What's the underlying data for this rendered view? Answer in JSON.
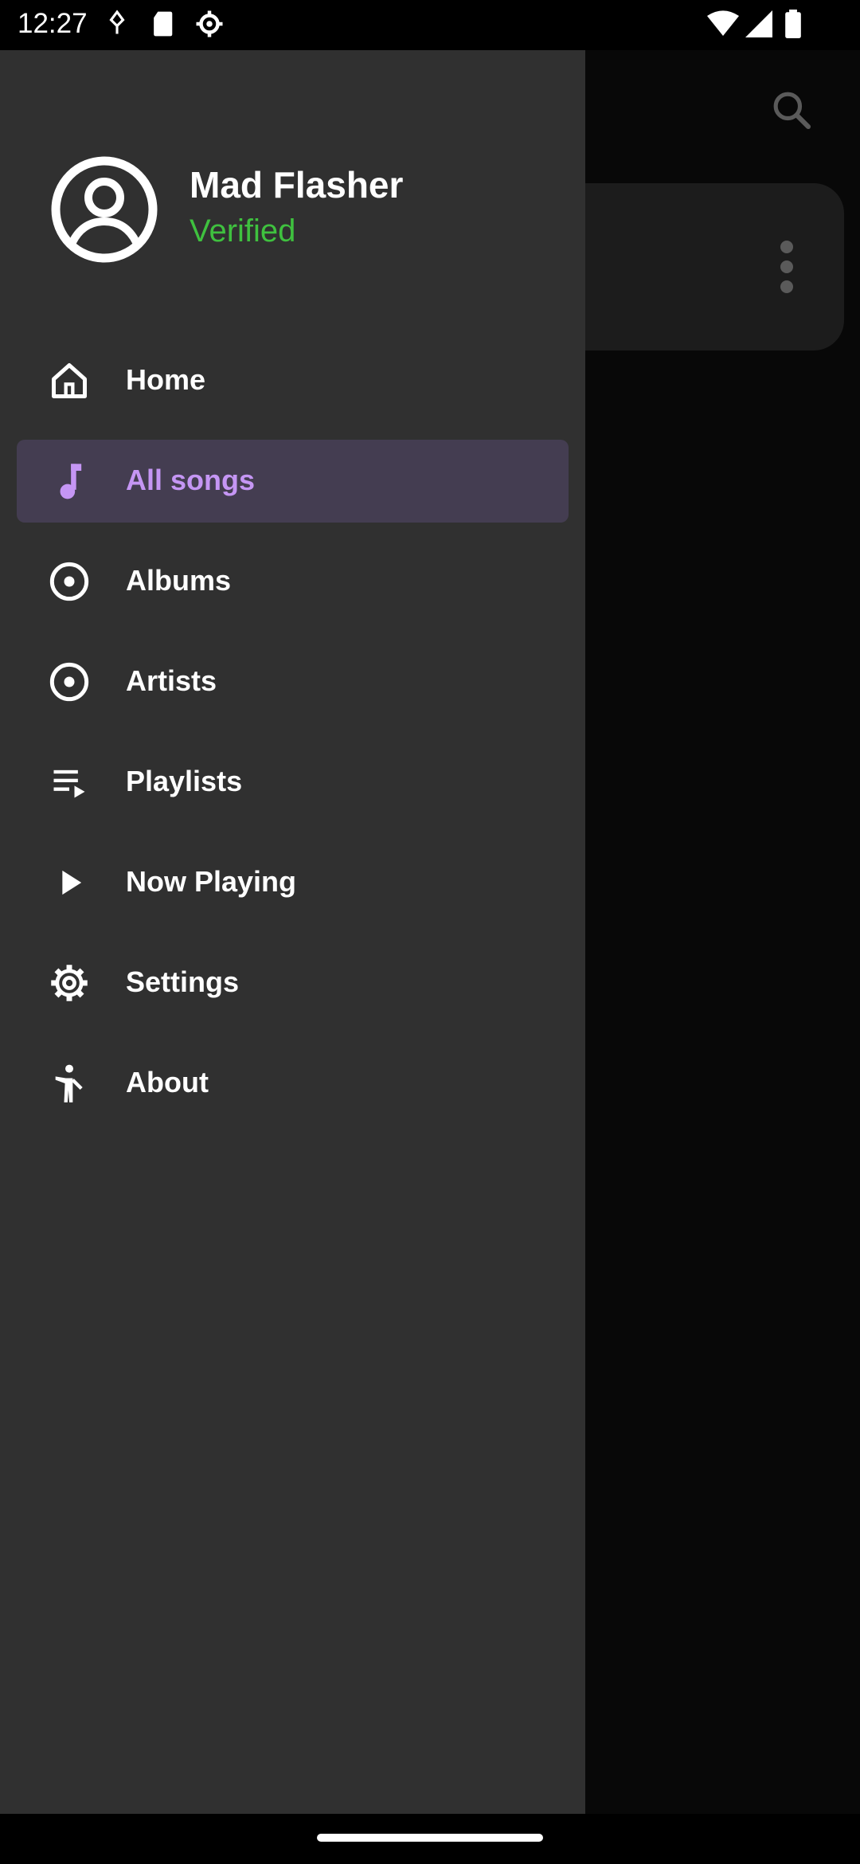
{
  "status_bar": {
    "time": "12:27",
    "icons": [
      "usb-debug-icon",
      "sd-card-icon",
      "settings-gear-icon",
      "wifi-icon",
      "cell-signal-icon",
      "battery-icon"
    ]
  },
  "background_app": {
    "search_icon": "search-icon",
    "more_icon": "more-vertical-icon"
  },
  "drawer": {
    "user": {
      "name": "Mad Flasher",
      "status": "Verified",
      "avatar_icon": "account-circle-icon"
    },
    "items": [
      {
        "label": "Home",
        "icon": "home-icon",
        "selected": false
      },
      {
        "label": "All songs",
        "icon": "music-note-icon",
        "selected": true
      },
      {
        "label": "Albums",
        "icon": "album-icon",
        "selected": false
      },
      {
        "label": "Artists",
        "icon": "artist-icon",
        "selected": false
      },
      {
        "label": "Playlists",
        "icon": "playlist-icon",
        "selected": false
      },
      {
        "label": "Now Playing",
        "icon": "play-icon",
        "selected": false
      },
      {
        "label": "Settings",
        "icon": "settings-icon",
        "selected": false
      },
      {
        "label": "About",
        "icon": "person-icon",
        "selected": false
      }
    ]
  },
  "colors": {
    "drawer_bg": "#303030",
    "selected_bg": "#443d51",
    "accent": "#c596f4",
    "verified": "#3fc13f"
  }
}
